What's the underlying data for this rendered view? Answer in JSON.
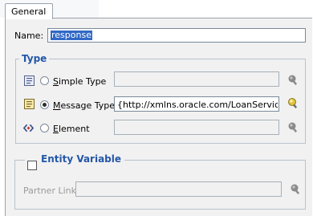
{
  "tabs": [
    {
      "label": "General"
    }
  ],
  "name": {
    "label": "Name:",
    "value": "response"
  },
  "type_group": {
    "title": "Type",
    "options": [
      {
        "label_mnemonic": "S",
        "label_rest": "imple Type",
        "selected": false,
        "value": ""
      },
      {
        "label_mnemonic": "M",
        "label_rest": "essage Type",
        "selected": true,
        "value": "{http://xmlns.oracle.com/LoanService}Loa"
      },
      {
        "label_mnemonic": "E",
        "label_rest": "lement",
        "selected": false,
        "value": ""
      }
    ]
  },
  "entity_group": {
    "title": "Entity Variable",
    "checked": false,
    "partner_link": {
      "label": "Partner Link:",
      "value": ""
    }
  },
  "icons": {
    "simple_type": "simple-type-icon",
    "message_type": "message-type-icon",
    "element": "element-icon",
    "browse": "flashlight-browse-icon"
  },
  "colors": {
    "accent": "#2457a8",
    "selection": "#3169c6",
    "panel": "#f1f1f1"
  }
}
